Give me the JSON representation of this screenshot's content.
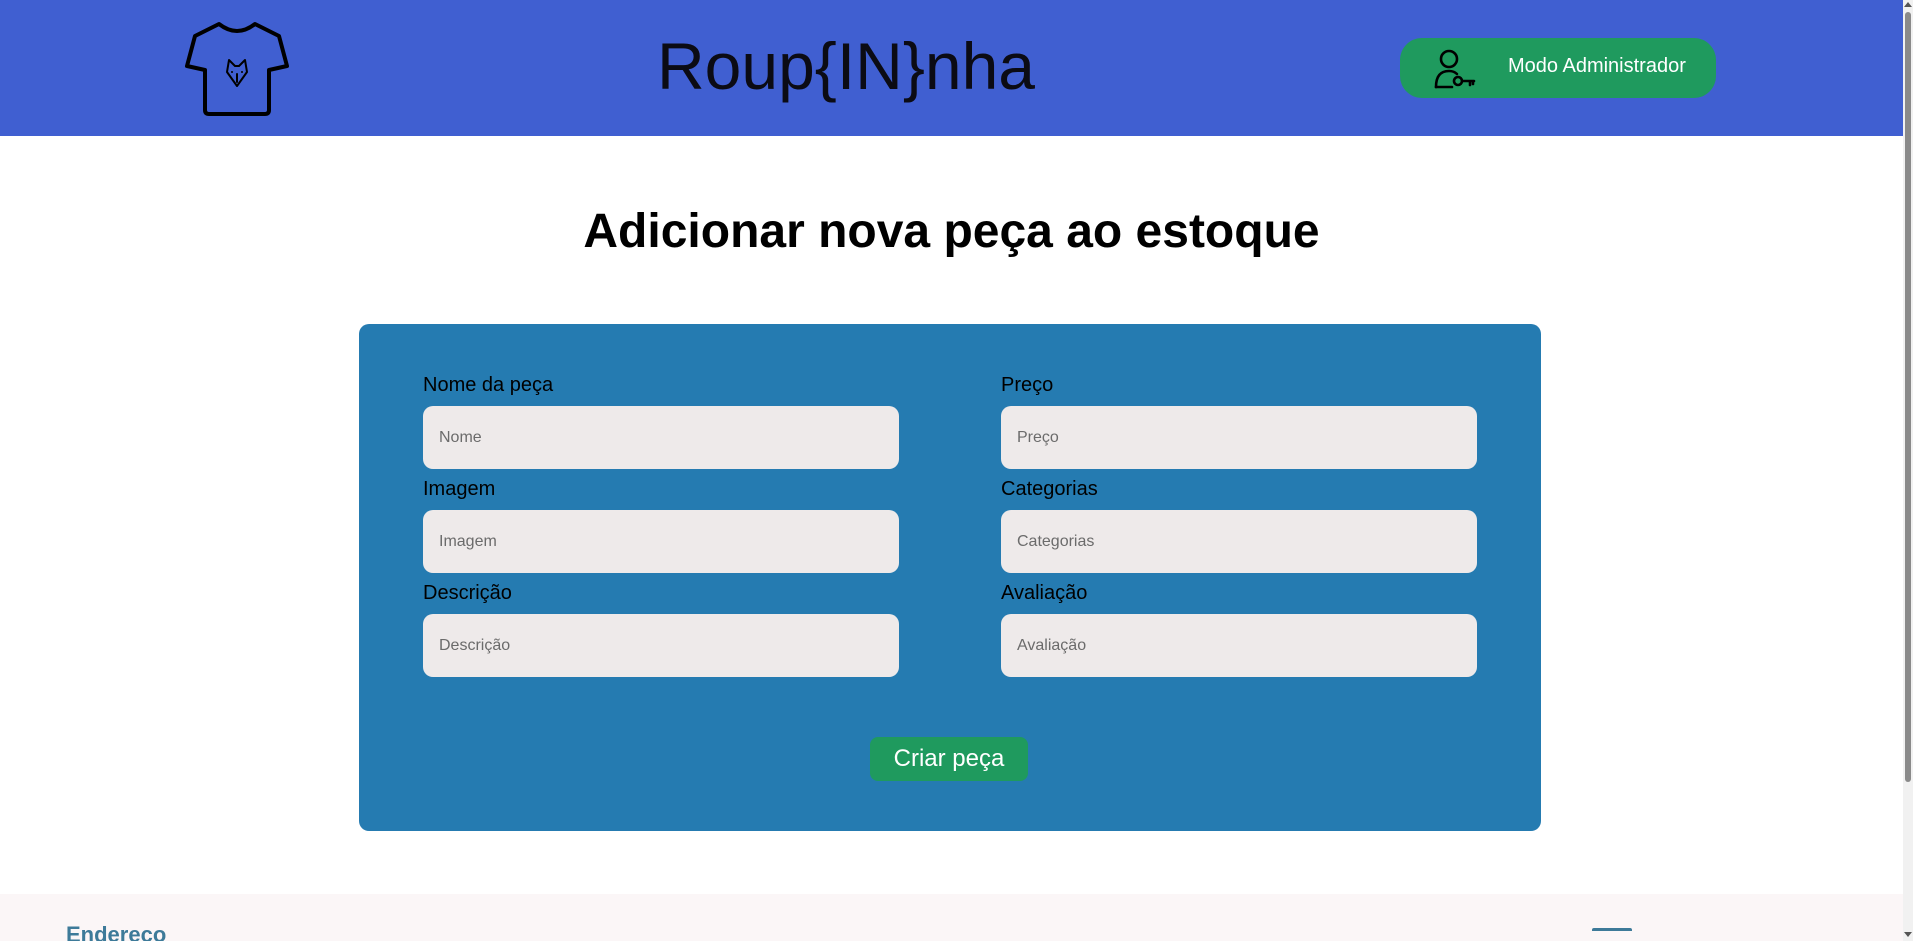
{
  "header": {
    "brand": "Roup{IN}nha",
    "logo_icon": "tshirt-fox-icon",
    "admin_button": {
      "label": "Modo Administrador",
      "icon": "user-key-icon"
    }
  },
  "main": {
    "title": "Adicionar nova peça ao estoque",
    "form": {
      "fields": [
        {
          "label": "Nome da peça",
          "placeholder": "Nome",
          "value": ""
        },
        {
          "label": "Preço",
          "placeholder": "Preço",
          "value": ""
        },
        {
          "label": "Imagem",
          "placeholder": "Imagem",
          "value": ""
        },
        {
          "label": "Categorias",
          "placeholder": "Categorias",
          "value": ""
        },
        {
          "label": "Descrição",
          "placeholder": "Descrição",
          "value": ""
        },
        {
          "label": "Avaliação",
          "placeholder": "Avaliação",
          "value": ""
        }
      ],
      "submit_label": "Criar peça"
    }
  },
  "footer": {
    "left_heading": "Endereço"
  },
  "colors": {
    "header_bg": "#405fd1",
    "accent_green": "#1f9a5e",
    "panel_bg": "#257bb1",
    "input_bg": "#eeeaea",
    "footer_bg": "#fbf6f7",
    "footer_text": "#3d7a99"
  }
}
